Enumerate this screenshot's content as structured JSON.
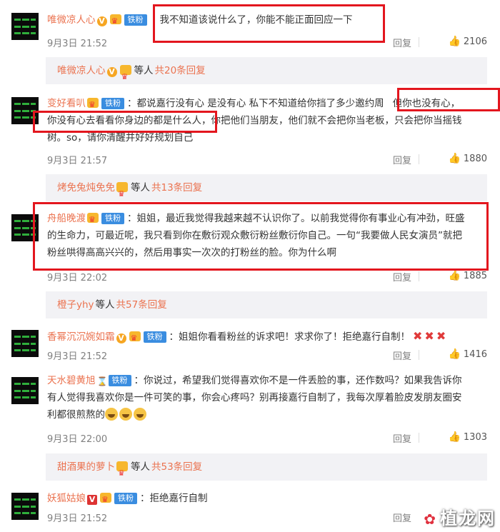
{
  "comments": [
    {
      "user": "唯微凉人心",
      "fans_badge": "铁粉",
      "text": "我不知道该说什么了，你能不能正面回应一下",
      "time": "9月3日 21:52",
      "reply": "回复",
      "likes": "2106",
      "sub": {
        "names": "唯微凉人心",
        "etc": "等人",
        "total": "共20条回复"
      }
    },
    {
      "user": "变好看叭",
      "fans_badge": "铁粉",
      "text_line1": "：都说嘉行没有心 是没有心 私下不知道给你挡了多少邀约周",
      "text_line1b": "但你也没有心，",
      "text_line2a": "你没有心去看看你身边的都是什么人，",
      "text_line2b": "你把他们当朋友，他们就不会把你当老板，只会把你当摇钱",
      "text_line3": "树。so，请你清醒并好好规划自己",
      "time": "9月3日 21:57",
      "reply": "回复",
      "likes": "1880",
      "sub": {
        "names": "烤免兔炖免免",
        "etc": "等人",
        "total": "共13条回复"
      }
    },
    {
      "user": "舟船晚渡",
      "fans_badge": "铁粉",
      "text_line1": "：姐姐，最近我觉得我越来越不认识你了。以前我觉得你有事业心有冲劲，旺盛",
      "text_line2": "的生命力，可最近呢，我只看到你在敷衍观众敷衍粉丝敷衍你自己。一句“我要做人民女演员”就把",
      "text_line3": "粉丝哄得高高兴兴的，然后用事实一次次的打粉丝的脸。你为什么啊",
      "time": "9月3日 22:02",
      "reply": "回复",
      "likes": "1885",
      "sub": {
        "names": "橙子yhy",
        "etc": "等人",
        "total": "共57条回复"
      }
    },
    {
      "user": "香幂沉沉婉如霜",
      "fans_badge": "铁粉",
      "text": "：姐姐你看看粉丝的诉求吧！求求你了！拒绝嘉行自制！",
      "time": "9月3日 21:52",
      "reply": "回复",
      "likes": "1416"
    },
    {
      "user": "天水碧黄旭",
      "fans_badge": "铁粉",
      "text_line1": "：你说过，希望我们觉得喜欢你不是一件丢脸的事，还作数吗？如果我告诉你",
      "text_line2": "有人觉得我喜欢你是一件可笑的事，你会心疼吗？别再接嘉行自制了，我每次厚着脸皮发朋友圈安",
      "text_line3": "利都很煎熬的",
      "time": "9月3日 22:00",
      "reply": "回复",
      "likes": "1303",
      "sub": {
        "names": "甜酒果的萝卜",
        "etc": "等人",
        "total": "共53条回复"
      }
    },
    {
      "user": "妖狐姑娘",
      "fans_badge": "铁粉",
      "text": "：拒绝嘉行自制",
      "time": "9月3日 21:52",
      "reply": "回复"
    }
  ],
  "watermark": "植龙网",
  "colors": {
    "username": "#eb7350",
    "highlight": "#e3161e",
    "fans_badge": "#3a8de0"
  }
}
